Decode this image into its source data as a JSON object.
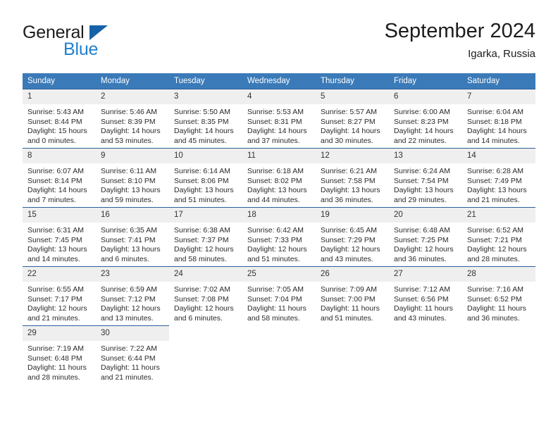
{
  "brand": {
    "name_part1": "General",
    "name_part2": "Blue",
    "logo_icon": "triangle-logo-icon"
  },
  "header": {
    "title": "September 2024",
    "location": "Igarka, Russia"
  },
  "calendar": {
    "weekday_headers": [
      "Sunday",
      "Monday",
      "Tuesday",
      "Wednesday",
      "Thursday",
      "Friday",
      "Saturday"
    ],
    "accent_color": "#3b7ab8",
    "rule_color": "#2a6099",
    "daynum_bg": "#efefef",
    "weeks": [
      [
        {
          "day": "1",
          "sunrise": "Sunrise: 5:43 AM",
          "sunset": "Sunset: 8:44 PM",
          "daylight_1": "Daylight: 15 hours",
          "daylight_2": "and 0 minutes."
        },
        {
          "day": "2",
          "sunrise": "Sunrise: 5:46 AM",
          "sunset": "Sunset: 8:39 PM",
          "daylight_1": "Daylight: 14 hours",
          "daylight_2": "and 53 minutes."
        },
        {
          "day": "3",
          "sunrise": "Sunrise: 5:50 AM",
          "sunset": "Sunset: 8:35 PM",
          "daylight_1": "Daylight: 14 hours",
          "daylight_2": "and 45 minutes."
        },
        {
          "day": "4",
          "sunrise": "Sunrise: 5:53 AM",
          "sunset": "Sunset: 8:31 PM",
          "daylight_1": "Daylight: 14 hours",
          "daylight_2": "and 37 minutes."
        },
        {
          "day": "5",
          "sunrise": "Sunrise: 5:57 AM",
          "sunset": "Sunset: 8:27 PM",
          "daylight_1": "Daylight: 14 hours",
          "daylight_2": "and 30 minutes."
        },
        {
          "day": "6",
          "sunrise": "Sunrise: 6:00 AM",
          "sunset": "Sunset: 8:23 PM",
          "daylight_1": "Daylight: 14 hours",
          "daylight_2": "and 22 minutes."
        },
        {
          "day": "7",
          "sunrise": "Sunrise: 6:04 AM",
          "sunset": "Sunset: 8:18 PM",
          "daylight_1": "Daylight: 14 hours",
          "daylight_2": "and 14 minutes."
        }
      ],
      [
        {
          "day": "8",
          "sunrise": "Sunrise: 6:07 AM",
          "sunset": "Sunset: 8:14 PM",
          "daylight_1": "Daylight: 14 hours",
          "daylight_2": "and 7 minutes."
        },
        {
          "day": "9",
          "sunrise": "Sunrise: 6:11 AM",
          "sunset": "Sunset: 8:10 PM",
          "daylight_1": "Daylight: 13 hours",
          "daylight_2": "and 59 minutes."
        },
        {
          "day": "10",
          "sunrise": "Sunrise: 6:14 AM",
          "sunset": "Sunset: 8:06 PM",
          "daylight_1": "Daylight: 13 hours",
          "daylight_2": "and 51 minutes."
        },
        {
          "day": "11",
          "sunrise": "Sunrise: 6:18 AM",
          "sunset": "Sunset: 8:02 PM",
          "daylight_1": "Daylight: 13 hours",
          "daylight_2": "and 44 minutes."
        },
        {
          "day": "12",
          "sunrise": "Sunrise: 6:21 AM",
          "sunset": "Sunset: 7:58 PM",
          "daylight_1": "Daylight: 13 hours",
          "daylight_2": "and 36 minutes."
        },
        {
          "day": "13",
          "sunrise": "Sunrise: 6:24 AM",
          "sunset": "Sunset: 7:54 PM",
          "daylight_1": "Daylight: 13 hours",
          "daylight_2": "and 29 minutes."
        },
        {
          "day": "14",
          "sunrise": "Sunrise: 6:28 AM",
          "sunset": "Sunset: 7:49 PM",
          "daylight_1": "Daylight: 13 hours",
          "daylight_2": "and 21 minutes."
        }
      ],
      [
        {
          "day": "15",
          "sunrise": "Sunrise: 6:31 AM",
          "sunset": "Sunset: 7:45 PM",
          "daylight_1": "Daylight: 13 hours",
          "daylight_2": "and 14 minutes."
        },
        {
          "day": "16",
          "sunrise": "Sunrise: 6:35 AM",
          "sunset": "Sunset: 7:41 PM",
          "daylight_1": "Daylight: 13 hours",
          "daylight_2": "and 6 minutes."
        },
        {
          "day": "17",
          "sunrise": "Sunrise: 6:38 AM",
          "sunset": "Sunset: 7:37 PM",
          "daylight_1": "Daylight: 12 hours",
          "daylight_2": "and 58 minutes."
        },
        {
          "day": "18",
          "sunrise": "Sunrise: 6:42 AM",
          "sunset": "Sunset: 7:33 PM",
          "daylight_1": "Daylight: 12 hours",
          "daylight_2": "and 51 minutes."
        },
        {
          "day": "19",
          "sunrise": "Sunrise: 6:45 AM",
          "sunset": "Sunset: 7:29 PM",
          "daylight_1": "Daylight: 12 hours",
          "daylight_2": "and 43 minutes."
        },
        {
          "day": "20",
          "sunrise": "Sunrise: 6:48 AM",
          "sunset": "Sunset: 7:25 PM",
          "daylight_1": "Daylight: 12 hours",
          "daylight_2": "and 36 minutes."
        },
        {
          "day": "21",
          "sunrise": "Sunrise: 6:52 AM",
          "sunset": "Sunset: 7:21 PM",
          "daylight_1": "Daylight: 12 hours",
          "daylight_2": "and 28 minutes."
        }
      ],
      [
        {
          "day": "22",
          "sunrise": "Sunrise: 6:55 AM",
          "sunset": "Sunset: 7:17 PM",
          "daylight_1": "Daylight: 12 hours",
          "daylight_2": "and 21 minutes."
        },
        {
          "day": "23",
          "sunrise": "Sunrise: 6:59 AM",
          "sunset": "Sunset: 7:12 PM",
          "daylight_1": "Daylight: 12 hours",
          "daylight_2": "and 13 minutes."
        },
        {
          "day": "24",
          "sunrise": "Sunrise: 7:02 AM",
          "sunset": "Sunset: 7:08 PM",
          "daylight_1": "Daylight: 12 hours",
          "daylight_2": "and 6 minutes."
        },
        {
          "day": "25",
          "sunrise": "Sunrise: 7:05 AM",
          "sunset": "Sunset: 7:04 PM",
          "daylight_1": "Daylight: 11 hours",
          "daylight_2": "and 58 minutes."
        },
        {
          "day": "26",
          "sunrise": "Sunrise: 7:09 AM",
          "sunset": "Sunset: 7:00 PM",
          "daylight_1": "Daylight: 11 hours",
          "daylight_2": "and 51 minutes."
        },
        {
          "day": "27",
          "sunrise": "Sunrise: 7:12 AM",
          "sunset": "Sunset: 6:56 PM",
          "daylight_1": "Daylight: 11 hours",
          "daylight_2": "and 43 minutes."
        },
        {
          "day": "28",
          "sunrise": "Sunrise: 7:16 AM",
          "sunset": "Sunset: 6:52 PM",
          "daylight_1": "Daylight: 11 hours",
          "daylight_2": "and 36 minutes."
        }
      ],
      [
        {
          "day": "29",
          "sunrise": "Sunrise: 7:19 AM",
          "sunset": "Sunset: 6:48 PM",
          "daylight_1": "Daylight: 11 hours",
          "daylight_2": "and 28 minutes."
        },
        {
          "day": "30",
          "sunrise": "Sunrise: 7:22 AM",
          "sunset": "Sunset: 6:44 PM",
          "daylight_1": "Daylight: 11 hours",
          "daylight_2": "and 21 minutes."
        },
        null,
        null,
        null,
        null,
        null
      ]
    ]
  }
}
